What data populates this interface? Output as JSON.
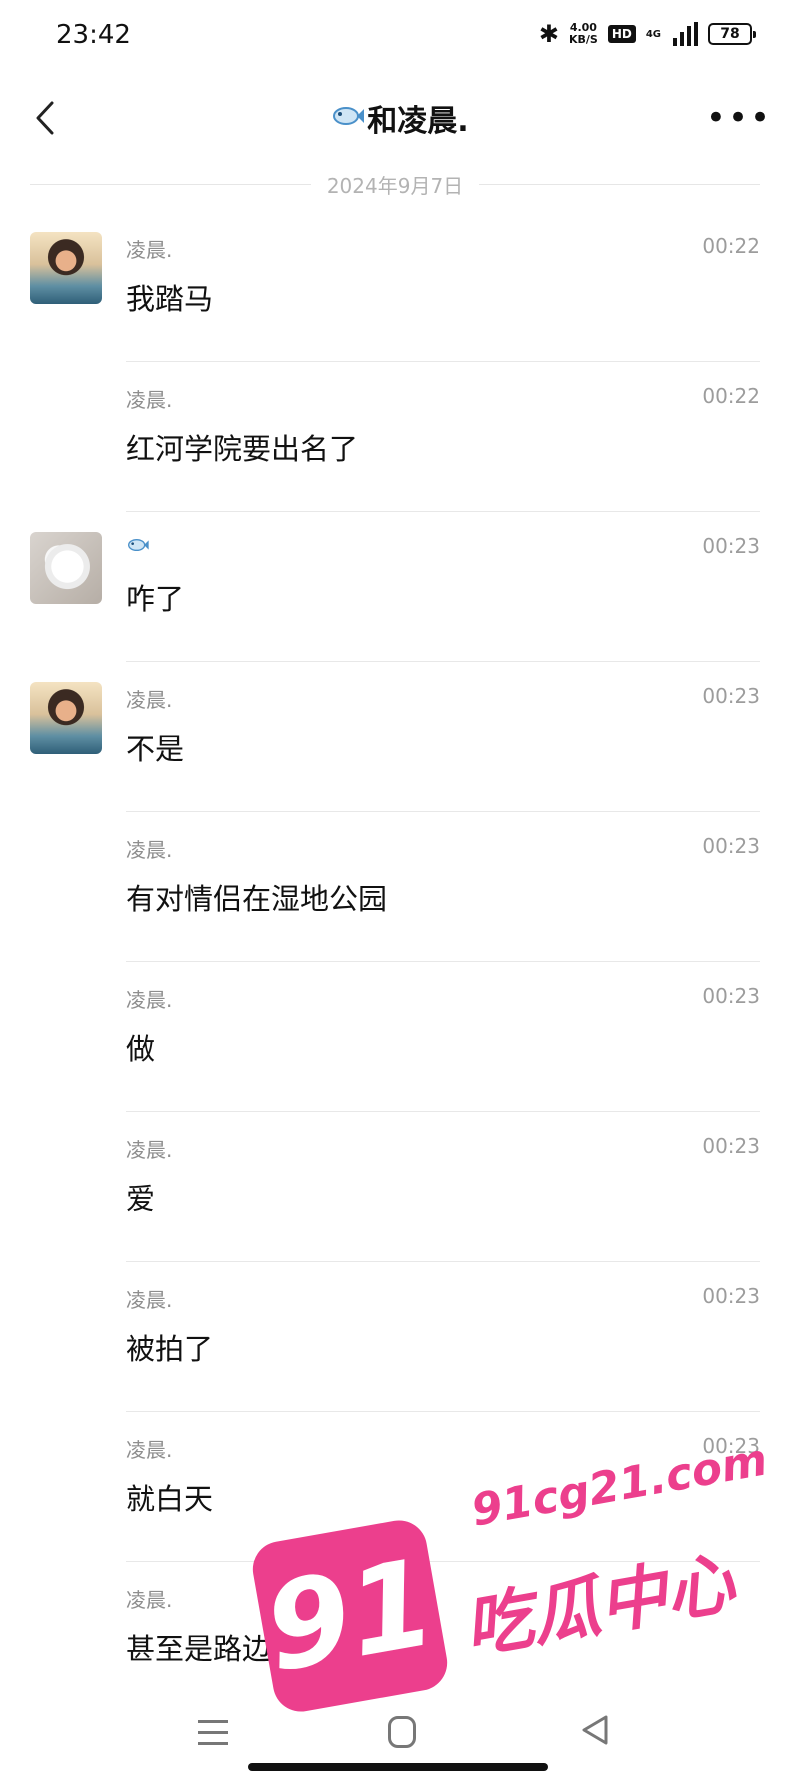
{
  "status_bar": {
    "time": "23:42",
    "network_speed_value": "4.00",
    "network_speed_unit": "KB/S",
    "hd_label": "HD",
    "signal_label": "4G",
    "battery": "78"
  },
  "header": {
    "title": "和凌晨.",
    "more_label": "•••"
  },
  "date_divider": "2024年9月7日",
  "messages": [
    {
      "sender": "凌晨.",
      "time": "00:22",
      "text": "我踏马"
    },
    {
      "sender": "凌晨.",
      "time": "00:22",
      "text": "红河学院要出名了"
    },
    {
      "sender": "",
      "time": "00:23",
      "text": "咋了"
    },
    {
      "sender": "凌晨.",
      "time": "00:23",
      "text": "不是"
    },
    {
      "sender": "凌晨.",
      "time": "00:23",
      "text": "有对情侣在湿地公园"
    },
    {
      "sender": "凌晨.",
      "time": "00:23",
      "text": "做"
    },
    {
      "sender": "凌晨.",
      "time": "00:23",
      "text": "爱"
    },
    {
      "sender": "凌晨.",
      "time": "00:23",
      "text": "被拍了"
    },
    {
      "sender": "凌晨.",
      "time": "00:23",
      "text": "就白天"
    },
    {
      "sender": "凌晨.",
      "time": "",
      "text": "甚至是路边很多人还路过"
    }
  ],
  "watermark": {
    "number": "91",
    "url": "91cg21.com",
    "text": "吃瓜中心"
  },
  "colors": {
    "watermark": "#ec3f8d",
    "fish_icon": "#4a90c9"
  }
}
